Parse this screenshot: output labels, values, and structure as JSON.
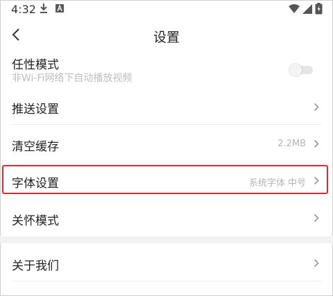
{
  "status_bar": {
    "time": "4:32",
    "icons": [
      "download-icon",
      "app-notification-icon",
      "wifi-icon",
      "signal-icon",
      "battery-icon"
    ]
  },
  "header": {
    "title": "设置",
    "back_icon": "chevron-left-icon"
  },
  "settings": {
    "free_mode": {
      "label": "任性模式",
      "subtitle": "非Wi-Fi网络下自动播放视频",
      "enabled": false
    },
    "push": {
      "label": "推送设置"
    },
    "clear_cache": {
      "label": "清空缓存",
      "value": "2.2MB"
    },
    "font": {
      "label": "字体设置",
      "value": "系统字体 中号",
      "highlighted": true
    },
    "care_mode": {
      "label": "关怀模式"
    },
    "about": {
      "label": "关于我们"
    }
  },
  "colors": {
    "highlight": "#e0262b",
    "text_primary": "#222222",
    "text_secondary": "#b5b5b5",
    "chevron": "#8f96a3",
    "section_gap": "#f2f2f2"
  }
}
